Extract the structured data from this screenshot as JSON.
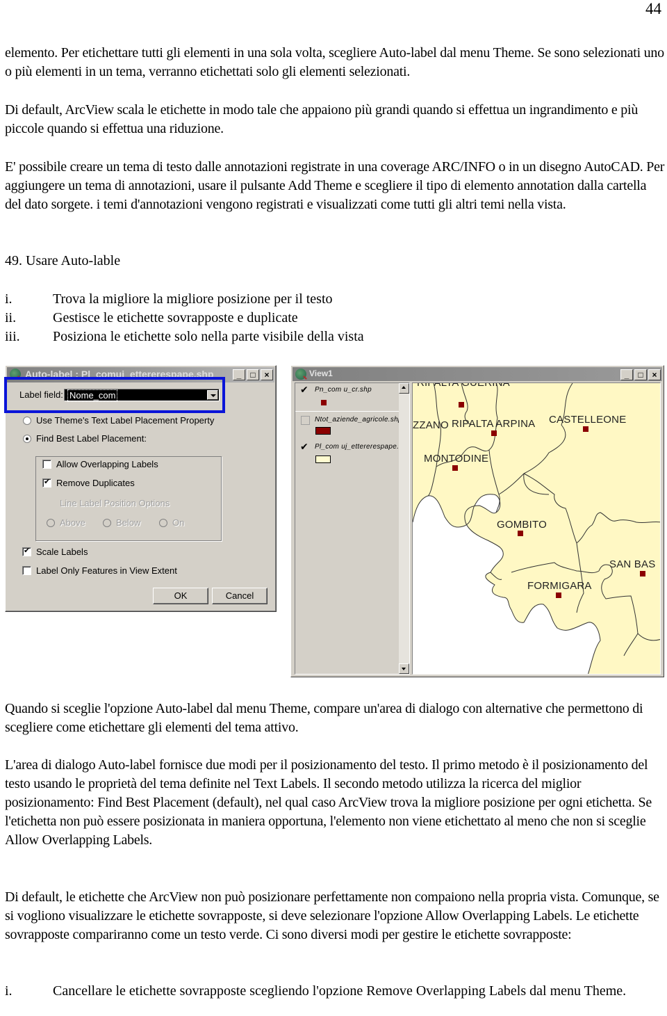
{
  "page_number": "44",
  "paragraphs": {
    "p1": "elemento. Per etichettare tutti gli elementi in una sola volta, scegliere Auto-label dal menu Theme. Se sono selezionati uno o più elementi in un tema, verranno etichettati solo gli elementi selezionati.",
    "p2": "Di default, ArcView scala le etichette in modo tale che appaiono più grandi quando si effettua un ingrandimento e più piccole quando si effettua una riduzione.",
    "p3": "E' possibile creare un tema di testo dalle annotazioni registrate in una coverage ARC/INFO o in un disegno AutoCAD. Per aggiungere un tema di annotazioni, usare il pulsante Add Theme e scegliere il tipo di elemento annotation dalla cartella del dato sorgete. i temi d'annotazioni vengono registrati e visualizzati come tutti gli altri temi nella vista.",
    "p4": "Quando si sceglie l'opzione Auto-label dal menu Theme, compare un'area di dialogo con alternative che permettono di scegliere come etichettare gli elementi del tema attivo.",
    "p5": "L'area di dialogo Auto-label fornisce due modi per il posizionamento del testo. Il primo metodo è il posizionamento del testo usando le proprietà del tema definite nel Text Labels. Il secondo metodo utilizza la ricerca del miglior posizionamento: Find Best Placement (default), nel qual caso ArcView trova la migliore posizione per ogni etichetta. Se l'etichetta non può essere posizionata in maniera opportuna, l'elemento non viene etichettato al meno che non si sceglie Allow Overlapping Labels.",
    "p6": "Di default, le etichette che ArcView non può posizionare perfettamente non compaiono nella propria vista. Comunque, se si vogliono visualizzare le etichette sovrapposte, si deve selezionare l'opzione Allow Overlapping Labels. Le etichette sovrapposte compariranno come un testo verde. Ci sono diversi modi per gestire le etichette sovrapposte:"
  },
  "section_heading": "49. Usare Auto-lable",
  "features_list": [
    {
      "num": "i.",
      "text": "Trova la migliore la migliore posizione per il testo"
    },
    {
      "num": "ii.",
      "text": "Gestisce le etichette sovrapposte e duplicate"
    },
    {
      "num": "iii.",
      "text": "Posiziona le etichette solo nella parte visibile della vista"
    }
  ],
  "bottom_list": [
    {
      "num": "i.",
      "text": "Cancellare le etichette sovrapposte scegliendo l'opzione Remove Overlapping Labels dal menu Theme."
    }
  ],
  "dialog": {
    "title": "Auto-label : Pl_comuj_ettererespape.shp",
    "window_buttons": {
      "minimize": "_",
      "maximize": "□",
      "close": "×"
    },
    "label_field_label": "Label field:",
    "label_field_value": "Nome_com",
    "radio_use_theme": {
      "label": "Use Theme's Text Label Placement Property",
      "checked": false
    },
    "radio_find_best": {
      "label": "Find Best Label Placement:",
      "checked": true
    },
    "check_allow_overlap": {
      "label": "Allow Overlapping Labels",
      "checked": false
    },
    "check_remove_duplicates": {
      "label": "Remove Duplicates",
      "checked": true
    },
    "line_label_group": "Line Label Position Options",
    "line_options": [
      {
        "label": "Above",
        "enabled": false
      },
      {
        "label": "Below",
        "enabled": false
      },
      {
        "label": "On",
        "enabled": false
      }
    ],
    "check_scale_labels": {
      "label": "Scale Labels",
      "checked": true
    },
    "check_view_extent": {
      "label": "Label Only Features in View Extent",
      "checked": false
    },
    "ok_label": "OK",
    "cancel_label": "Cancel",
    "highlight_color": "#0a14d8"
  },
  "view_window": {
    "title": "View1",
    "themes": [
      {
        "name": "Pn_com u_cr.shp",
        "visible": true,
        "symbol": "point",
        "color": "#8b0000"
      },
      {
        "name": "Ntot_aziende_agricole.shp",
        "visible": false,
        "symbol": "fill",
        "color": "#8b0000"
      },
      {
        "name": "Pl_com uj_ettererespape.s",
        "visible": true,
        "symbol": "fill",
        "color": "#fffbd0"
      }
    ],
    "map_labels": [
      {
        "name": "RIPALTA GUERINA",
        "partial": true
      },
      {
        "name": "ZZANO",
        "partial": true
      },
      {
        "name": "RIPALTA ARPINA",
        "partial": false
      },
      {
        "name": "CASTELLEONE",
        "partial": false
      },
      {
        "name": "MONTODINE",
        "partial": false
      },
      {
        "name": "GOMBITO",
        "partial": false
      },
      {
        "name": "SAN BAS",
        "partial": true
      },
      {
        "name": "FORMIGARA",
        "partial": false
      }
    ],
    "polygon_fill": "#fff8c4",
    "point_color": "#8b0000"
  }
}
